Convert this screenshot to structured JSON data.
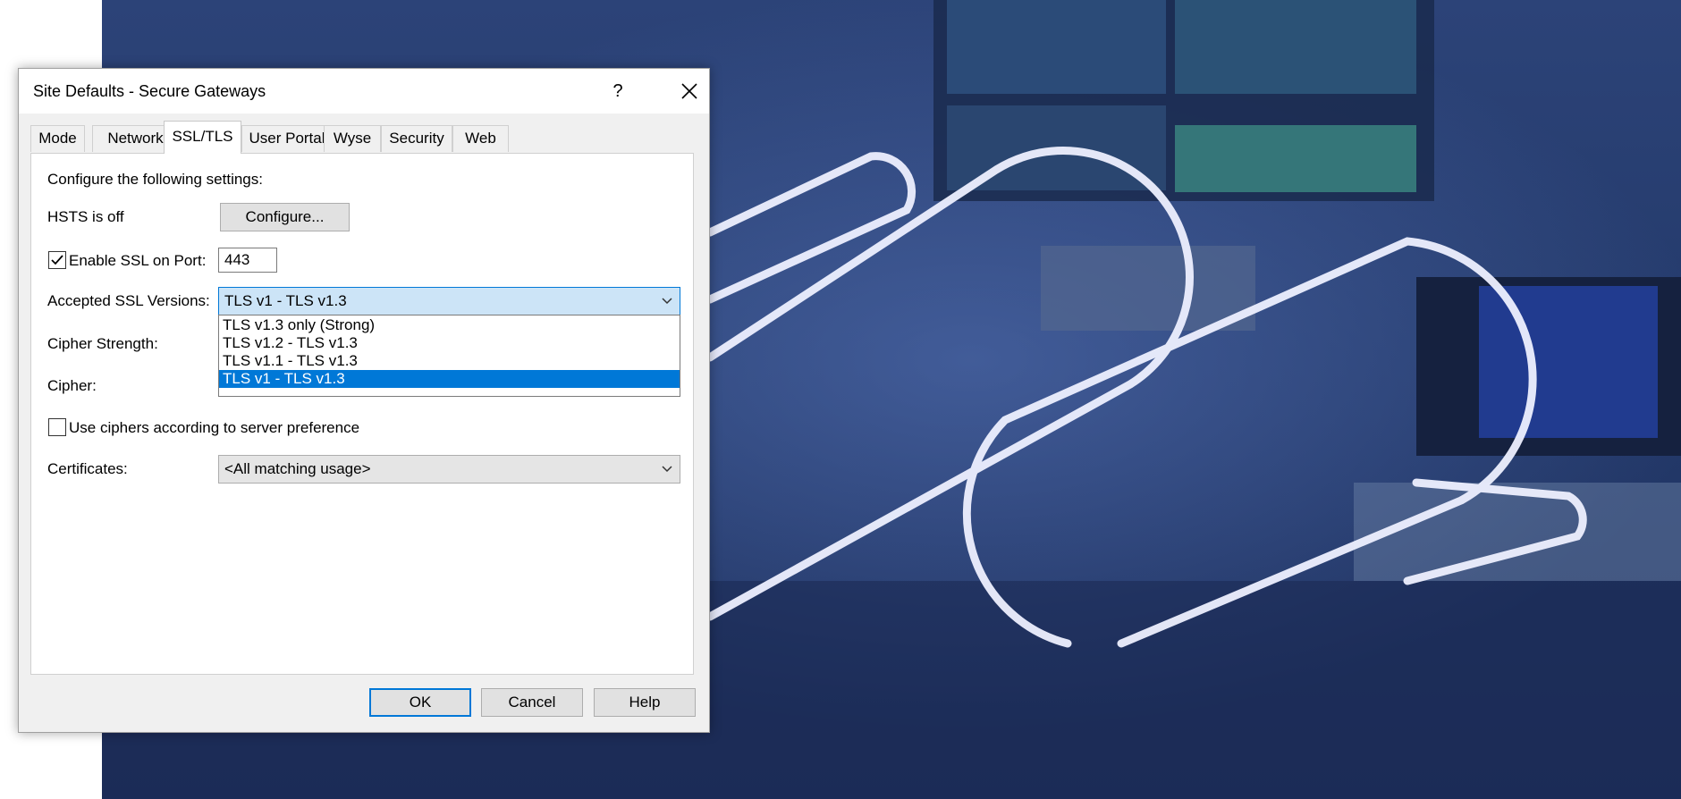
{
  "dialog": {
    "title": "Site Defaults - Secure Gateways",
    "help_label": "?"
  },
  "tabs": [
    {
      "label": "Mode"
    },
    {
      "label": "Network"
    },
    {
      "label": "SSL/TLS",
      "active": true
    },
    {
      "label": "User Portal"
    },
    {
      "label": "Wyse"
    },
    {
      "label": "Security"
    },
    {
      "label": "Web"
    }
  ],
  "settings": {
    "intro": "Configure the following settings:",
    "hsts_status": "HSTS is off",
    "configure_label": "Configure...",
    "enable_ssl_label": "Enable SSL on Port:",
    "enable_ssl_checked": true,
    "port_value": "443",
    "accepted_versions_label": "Accepted SSL Versions:",
    "accepted_versions_value": "TLS v1 - TLS v1.3",
    "accepted_versions_options": [
      "TLS v1.3 only (Strong)",
      "TLS v1.2 - TLS v1.3",
      "TLS v1.1 - TLS v1.3",
      "TLS v1 - TLS v1.3"
    ],
    "cipher_strength_label": "Cipher Strength:",
    "cipher_label": "Cipher:",
    "server_pref_label": "Use ciphers according to server preference",
    "server_pref_checked": false,
    "certificates_label": "Certificates:",
    "certificates_value": "<All matching usage>"
  },
  "footer": {
    "ok_label": "OK",
    "cancel_label": "Cancel",
    "help_label": "Help"
  },
  "colors": {
    "accent": "#0078d7",
    "background": "#263d70"
  }
}
